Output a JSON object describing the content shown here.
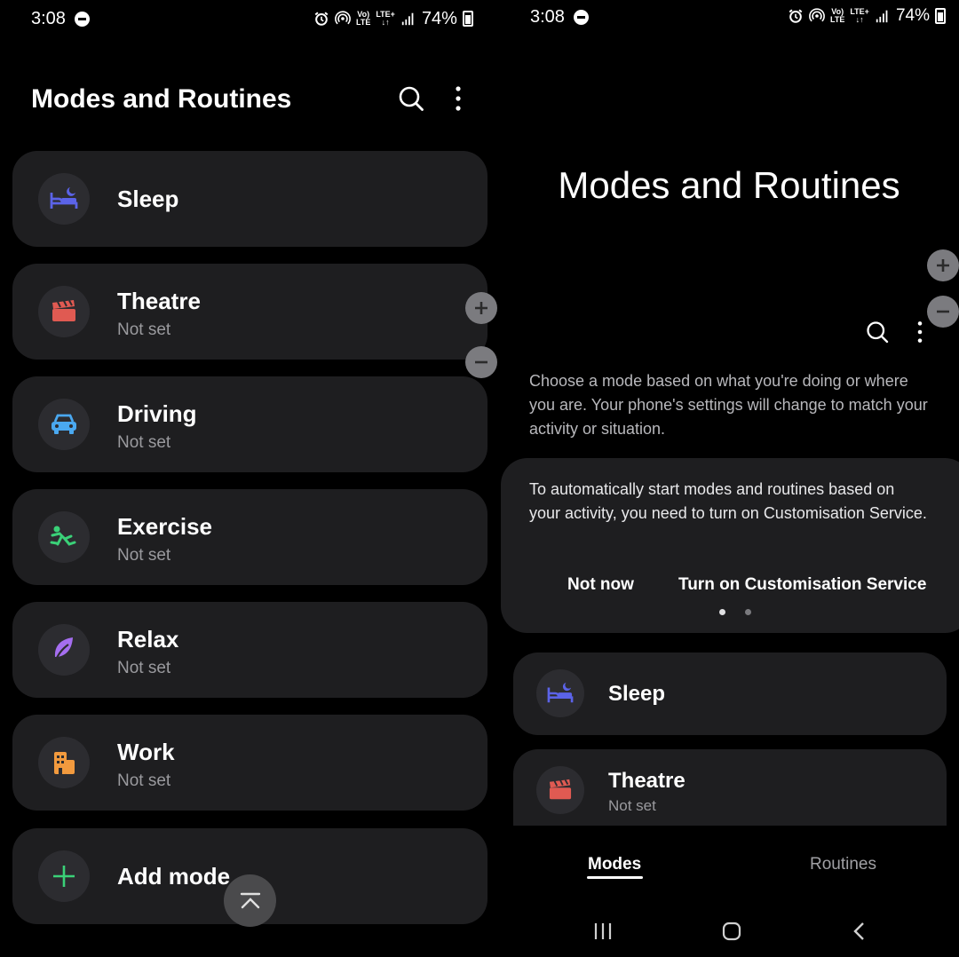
{
  "status": {
    "time": "3:08",
    "battery": "74%",
    "network_top": "Vo)",
    "network_bottom": "LTE",
    "lte_top": "LTE+",
    "lte_arrows": "↓↑"
  },
  "left": {
    "title": "Modes and Routines",
    "modes": [
      {
        "name": "Sleep",
        "sub": "",
        "icon": "bed-icon",
        "color": "#5b63e8"
      },
      {
        "name": "Theatre",
        "sub": "Not set",
        "icon": "clapperboard-icon",
        "color": "#e05a52"
      },
      {
        "name": "Driving",
        "sub": "Not set",
        "icon": "car-icon",
        "color": "#4aa8f0"
      },
      {
        "name": "Exercise",
        "sub": "Not set",
        "icon": "running-icon",
        "color": "#3ad178"
      },
      {
        "name": "Relax",
        "sub": "Not set",
        "icon": "leaf-icon",
        "color": "#a56ef0"
      },
      {
        "name": "Work",
        "sub": "Not set",
        "icon": "building-icon",
        "color": "#f29a3e"
      }
    ],
    "add_mode": "Add mode",
    "add_color": "#3ad178"
  },
  "right": {
    "title": "Modes and Routines",
    "description": "Choose a mode based on what you're doing or where you are. Your phone's settings will change to match your activity or situation.",
    "notice_text": "To automatically start modes and routines based on your activity, you need to turn on Customisation Service.",
    "not_now": "Not now",
    "turn_on": "Turn on Customisation Service",
    "modes": [
      {
        "name": "Sleep",
        "sub": ""
      },
      {
        "name": "Theatre",
        "sub": "Not set"
      }
    ],
    "tabs": [
      "Modes",
      "Routines"
    ]
  }
}
